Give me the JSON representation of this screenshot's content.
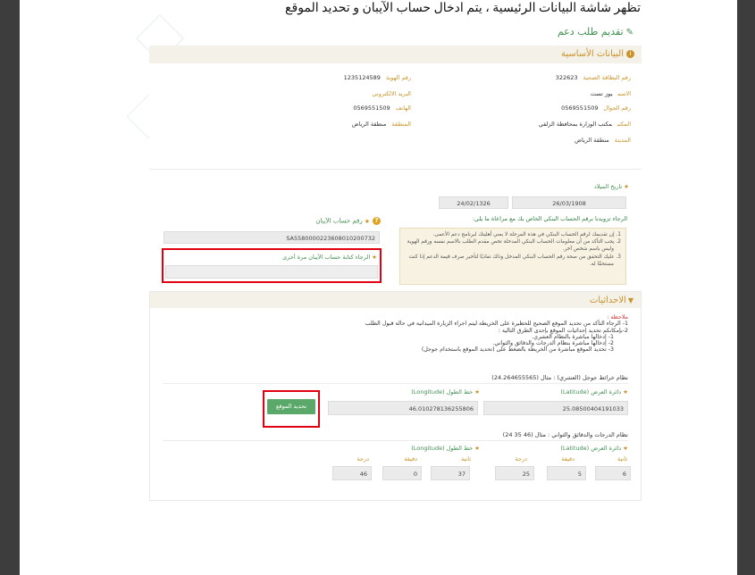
{
  "caption": "تظهر شاشة البيانات الرئيسية ، يتم ادخال حساب الآيبان و تحديد الموقع",
  "page_title": "تقديم طلب دعم",
  "basic": {
    "title": "البيانات الأساسية",
    "health_card_label": "رقم البطاقة الصحية",
    "health_card_value": "322623",
    "id_label": "رقم الهوية",
    "id_value": "1235124589",
    "name_label": "الاسم",
    "name_value": "يوز تست",
    "email_label": "البريد الالكتروني",
    "email_value": "",
    "mobile_label": "رقم الجوال",
    "mobile_value": "0569551509",
    "phone_label": "الهاتف",
    "phone_value": "0569551509",
    "office_label": "المكتب",
    "office_value": "مكتب الوزارة بمحافظة الزلفي",
    "region_label": "المنطقة",
    "region_value": "منطقة الرياض",
    "city_label": "المدينة",
    "city_value": "منطقة الرياض",
    "dob_label": "تاريخ الميلاد",
    "dob_gregorian": "26/03/1908",
    "dob_hijri": "24/02/1326",
    "bank_instruction": "الرجاء تزويدنا برقم الحساب البنكي الخاص بك مع مراعاة ما يلي:",
    "notes": [
      "1. إن تقديمك لرقم الحساب البنكي في هذه المرحلة لا يعني أهليتك لبرنامج دعم الأعمى.",
      "2. يجب التأكد من أن معلومات الحساب البنكي المدخلة تخص مقدم الطلب بالاسم نفسه ورقم الهوية",
      "وليس باسم شخص آخر.",
      "3. عليك التحقق من صحة رقم الحساب البنكي المدخل وذلك تفاديًا لتأخير صرف قيمة الدعم إذا كنت",
      "مستحقًا له."
    ],
    "iban_label": "رقم حساب الآيبان",
    "iban_value": "SA5580000223608010200732",
    "iban_confirm_label": "الرجاء كتابة حساب الآيبان مرة أخرى",
    "iban_confirm_value": ""
  },
  "coords": {
    "title": "الاحداثيات",
    "notes": [
      "ملاحظة :",
      "1- الرجاء التأكد من تحديد الموقع الصحيح للحظيرة على الخريطة ليتم اجراء الزيارة الميدانية في حالة قبول الطلب",
      "2-بإمكانكم تحديد إحداثيات الموقع بإحدى الطرق التالية :",
      "1- إدخالها مباشرة بالنظام العشري.",
      "2- إدخالها مباشرة بنظام الدرجات والدقائق والثواني.",
      "3- تحديد الموقع مباشرة من الخريطة بالضغط على (تحديد الموقع باستخدام جوجل)"
    ],
    "decimal_title": "نظام خرائط جوجل (العشري) : مثال (24.264655565)",
    "lat_label": "دائرة العرض (Latitude)",
    "lat_value": "25.08500404191033",
    "lng_label": "خط الطول (Longitude)",
    "lng_value": "46.010278136255806",
    "locate_button": "تحديد الموقع",
    "dms_title": "نظام الدرجات والدقائق والثواني : مثال (46 35 24)",
    "second_label": "ثانية",
    "minute_label": "دقيقة",
    "degree_label": "درجة",
    "lat_sec": "6",
    "lat_min": "5",
    "lat_deg": "25",
    "lng_sec": "37",
    "lng_min": "0",
    "lng_deg": "46"
  }
}
